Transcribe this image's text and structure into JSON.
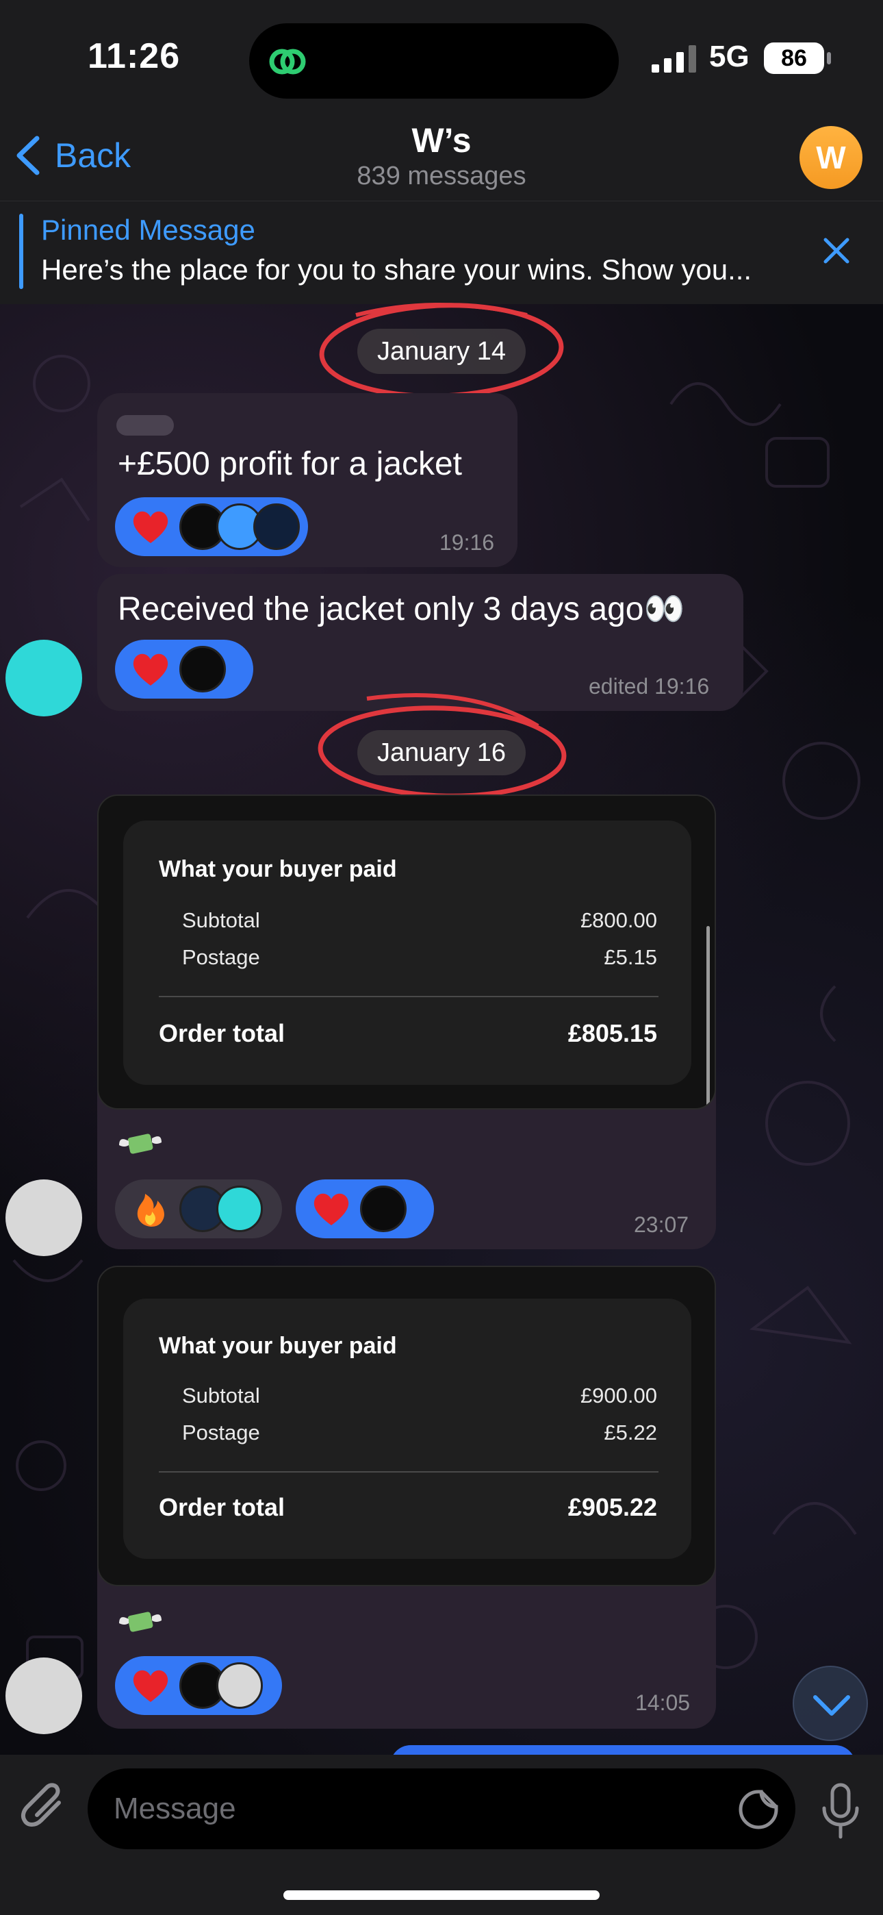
{
  "status": {
    "time": "11:26",
    "network": "5G",
    "battery": "86"
  },
  "header": {
    "back_label": "Back",
    "title": "W’s",
    "subtitle": "839 messages",
    "avatar_letter": "W"
  },
  "pinned": {
    "title": "Pinned Message",
    "text": "Here’s the place for you to share your wins. Show you..."
  },
  "dates": [
    "January 14",
    "January 16"
  ],
  "messages": [
    {
      "text": "+£500 profit for a jacket",
      "time": "19:16"
    },
    {
      "text": "Received the jacket only 3 days ago👀",
      "time": "edited 19:16"
    },
    {
      "receipt": {
        "title": "What your buyer paid",
        "subtotal_label": "Subtotal",
        "subtotal": "£800.00",
        "postage_label": "Postage",
        "postage": "£5.15",
        "total_label": "Order total",
        "total": "£805.15"
      },
      "time": "23:07"
    },
    {
      "receipt": {
        "title": "What your buyer paid",
        "subtotal_label": "Subtotal",
        "subtotal": "£900.00",
        "postage_label": "Postage",
        "postage": "£5.22",
        "total_label": "Order total",
        "total": "£905.22"
      },
      "time": "14:05"
    }
  ],
  "input": {
    "placeholder": "Message"
  },
  "colors": {
    "accent": "#3e9bff",
    "reaction_bg": "#3478f6",
    "bubble": "#2a2230",
    "annotation_red": "#e0383e"
  },
  "icons": [
    "back-chevron-icon",
    "close-icon",
    "heart-icon",
    "fire-icon",
    "money-wings-icon",
    "attach-icon",
    "sticker-icon",
    "mic-icon",
    "chevron-down-icon"
  ]
}
